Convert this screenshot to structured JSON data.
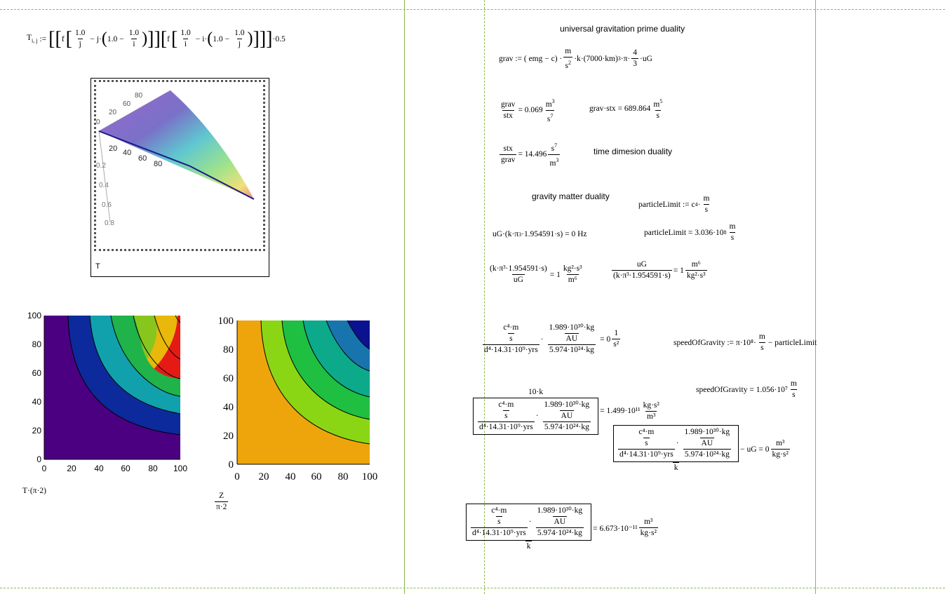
{
  "worksheet": {
    "def_T": {
      "lhs": "T",
      "lhs_sub": "i, j",
      "assign": ":=",
      "f": "f",
      "one": "1.0",
      "i": "i",
      "j": "j",
      "minus": "−",
      "power": "0.5",
      "dot": "·"
    },
    "plot3d": {
      "label": "T",
      "ticks_back": [
        "80",
        "60",
        "40",
        "20",
        "0"
      ],
      "ticks_front": [
        "20",
        "40",
        "60",
        "80"
      ],
      "ticks_z": [
        "0.2",
        "0.4",
        "0.6",
        "0.8"
      ]
    },
    "contour1": {
      "label": "T·(π·2)",
      "xticks": [
        "0",
        "20",
        "40",
        "60",
        "80",
        "100"
      ],
      "yticks": [
        "0",
        "20",
        "40",
        "60",
        "80",
        "100"
      ]
    },
    "contour2": {
      "label_num": "Z",
      "label_den": "π·2",
      "xticks": [
        "0",
        "20",
        "40",
        "60",
        "80",
        "100"
      ],
      "yticks": [
        "0",
        "20",
        "40",
        "60",
        "80",
        "100"
      ]
    },
    "headings": {
      "prime_duality": "universal gravitation prime duality",
      "time_duality": "time dimesion duality",
      "matter_duality": "gravity matter duality"
    },
    "eq_grav_def": {
      "lhs": "grav",
      "rhs_a": ":= ( emg − c) ·",
      "m": "m",
      "s2": "s",
      "rhs_b": "·k·(7000·km)",
      "exp3": "3",
      "rhs_c": "·π·",
      "four": "4",
      "three": "3",
      "rhs_d": "·uG"
    },
    "eq_grav_stx": {
      "num": "grav",
      "den": "stx",
      "eq": "= 0.069",
      "unit_num": "m",
      "unit_num_exp": "3",
      "unit_den": "s",
      "unit_den_exp": "7"
    },
    "eq_gravstx": {
      "lhs": "grav·stx",
      "eq": "= 689.864",
      "unit_num": "m",
      "unit_num_exp": "5",
      "unit_den": "s"
    },
    "eq_stx_grav": {
      "num": "stx",
      "den": "grav",
      "eq": "= 14.496",
      "unit_num": "s",
      "unit_num_exp": "7",
      "unit_den": "m",
      "unit_den_exp": "3"
    },
    "eq_particle_def": {
      "lhs": "particleLimit",
      "assign": ":= c",
      "exp": "4",
      "m": "m",
      "s": "s"
    },
    "eq_particle_val": {
      "lhs": "particleLimit",
      "eq": "= 3.036·10",
      "exp": "8",
      "m": "m",
      "s": "s"
    },
    "eq_uG": {
      "text": "uG·(k·π",
      "exp": "3",
      "text_b": "·1.954591·s)",
      "eq": "= 0 Hz"
    },
    "eq_ratio1": {
      "num": "(k·π³·1.954591·s)",
      "den": "uG",
      "eq": "= 1",
      "unit_num": "kg²·s³",
      "unit_den": "m⁶"
    },
    "eq_ratio2": {
      "num": "uG",
      "den": "(k·π³·1.954591·s)",
      "eq": "= 1",
      "unit_num": "m⁶",
      "unit_den": "kg²·s³"
    },
    "eq_big1": {
      "c4m": "c⁴·m",
      "s": "s",
      "d4": "d⁴·14.31·10⁹·yrs",
      "mass_num": "1.989·10³⁰·kg",
      "au": "AU",
      "mass_den": "5.974·10²⁴·kg",
      "eq": "= 0",
      "unit_num": "1",
      "unit_den": "s²"
    },
    "eq_speed_def": {
      "lhs": "speedOfGravity",
      "assign": ":= π·10⁸·",
      "m": "m",
      "s": "s",
      "tail": "− particleLimit"
    },
    "eq_speed_val": {
      "lhs": "speedOfGravity",
      "eq": "= 1.056·10⁷",
      "m": "m",
      "s": "s"
    },
    "eq_big2": {
      "num": "10·k",
      "eq": "= 1.499·10¹¹",
      "unit_num": "kg·s²",
      "unit_den": "m³"
    },
    "eq_big3": {
      "den": "k",
      "tail": "− uG = 0",
      "unit_num": "m³",
      "unit_den": "kg·s²"
    },
    "eq_big4": {
      "den": "k",
      "eq": "= 6.673·10⁻¹¹",
      "unit_num": "m³",
      "unit_den": "kg·s²"
    }
  },
  "colors": {
    "guide": "#8db84a",
    "c1_levels": [
      "#4b0082",
      "#0d2a9c",
      "#11a1ad",
      "#1fb34a",
      "#88c61e",
      "#e8b80a",
      "#e51a14"
    ],
    "c2_levels": [
      "#eea50b",
      "#8bd614",
      "#1fbf42",
      "#0ca98a",
      "#1874ad",
      "#0b1290"
    ]
  }
}
